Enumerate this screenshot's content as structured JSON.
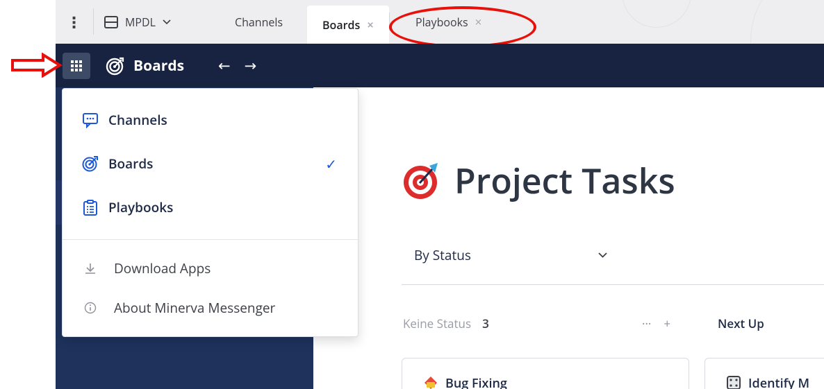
{
  "tabbar": {
    "server_name": "MPDL",
    "tabs": [
      {
        "label": "Channels",
        "closable": false
      },
      {
        "label": "Boards",
        "closable": true,
        "active": true
      },
      {
        "label": "Playbooks",
        "closable": true
      }
    ],
    "close_glyph": "×"
  },
  "header": {
    "app_name": "Boards",
    "back_glyph": "←",
    "forward_glyph": "→"
  },
  "menu": {
    "items": [
      {
        "label": "Channels",
        "icon": "channels-icon"
      },
      {
        "label": "Boards",
        "icon": "boards-icon",
        "checked": true
      },
      {
        "label": "Playbooks",
        "icon": "playbooks-icon"
      }
    ],
    "check_glyph": "✓",
    "secondary": [
      {
        "label": "Download Apps",
        "icon": "download-icon"
      },
      {
        "label": "About Minerva Messenger",
        "icon": "info-icon"
      }
    ]
  },
  "board": {
    "title": "Project Tasks",
    "view": "By Status",
    "columns": [
      {
        "name": "Keine Status",
        "count": "3"
      },
      {
        "name": "Next Up"
      }
    ],
    "column_actions": {
      "more": "···",
      "add": "+"
    },
    "cards": [
      {
        "title": "Bug Fixing"
      },
      {
        "title": "Identify M"
      }
    ]
  },
  "colors": {
    "header_bg": "#172340",
    "sidebar_bg": "#1e325c",
    "accent_blue": "#1c58d9",
    "annotation_red": "#e8100a"
  }
}
